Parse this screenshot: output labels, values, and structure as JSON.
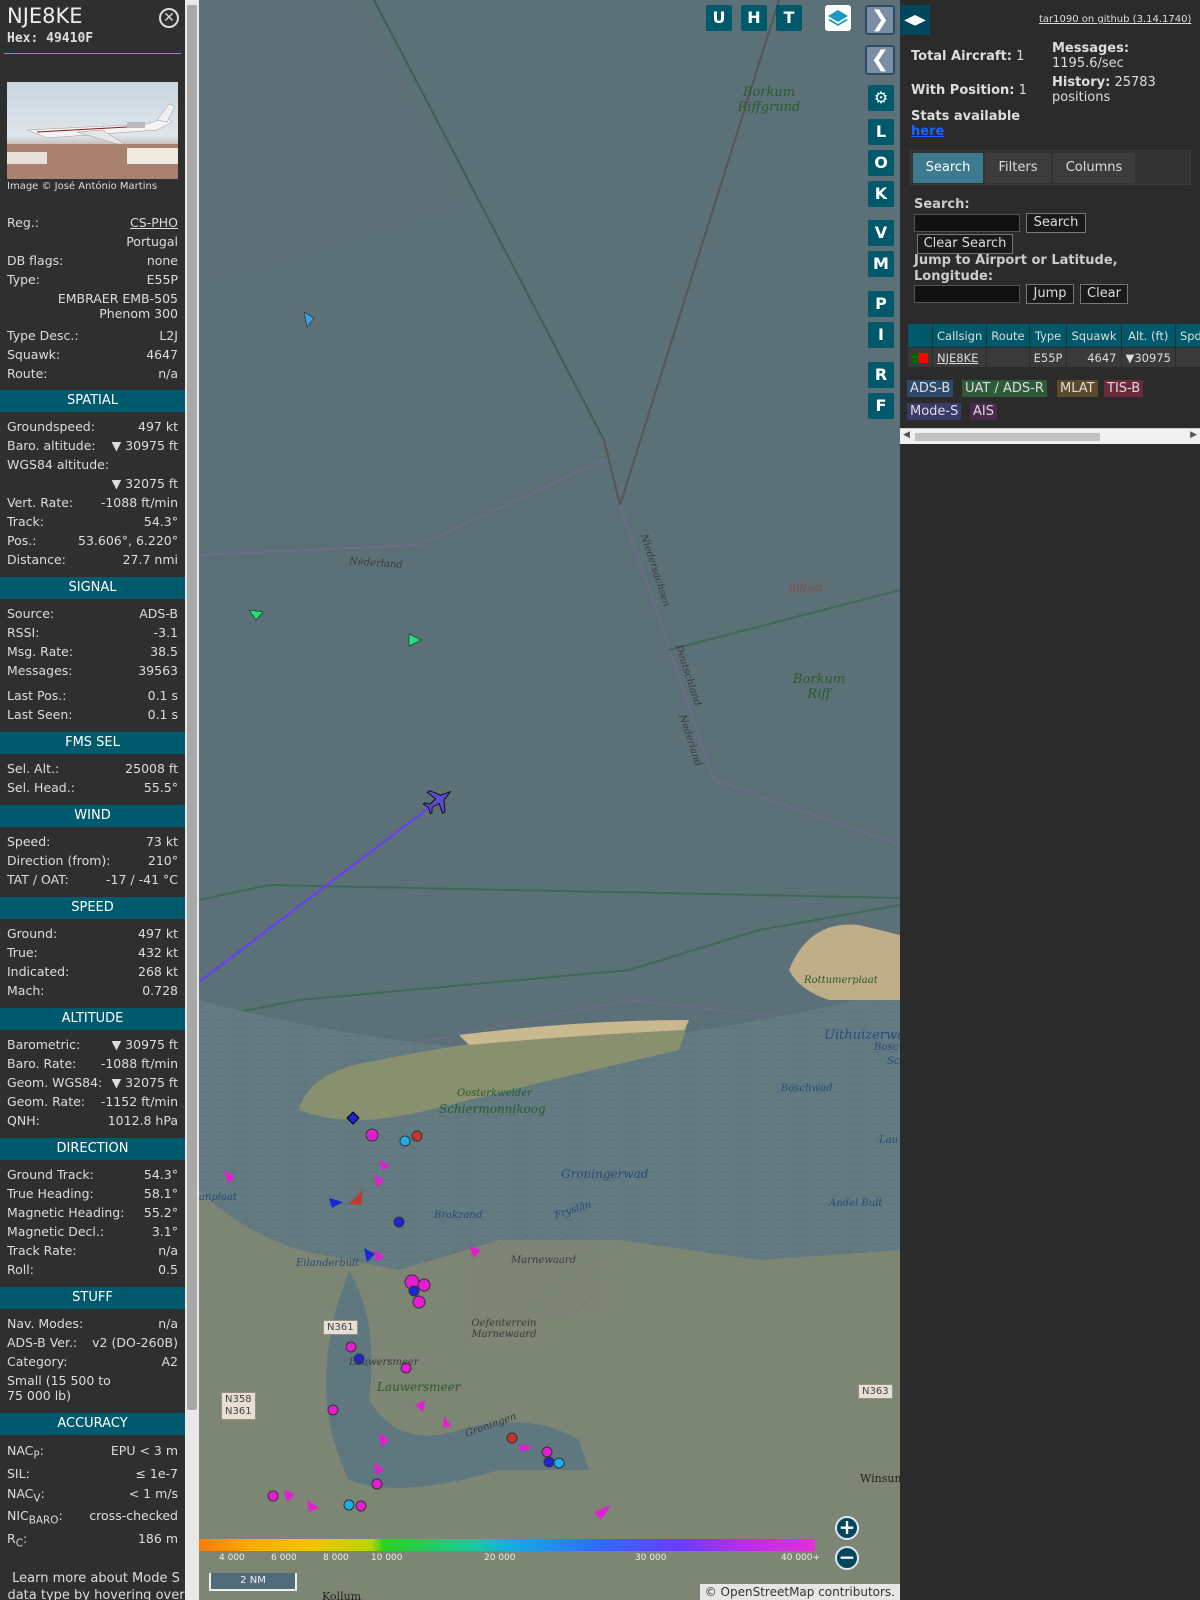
{
  "aircraft": {
    "callsign": "NJE8KE",
    "hex_label": "Hex:",
    "hex": "49410F",
    "photo_credit": "Image © José António Martins",
    "reg_label": "Reg.:",
    "reg": "CS-PHO",
    "country": "Portugal",
    "db_flags_label": "DB flags:",
    "db_flags": "none",
    "type_label": "Type:",
    "type": "E55P",
    "type_name": "EMBRAER EMB-505 Phenom 300",
    "type_desc_label": "Type Desc.:",
    "type_desc": "L2J",
    "squawk_label": "Squawk:",
    "squawk": "4647",
    "route_label": "Route:",
    "route": "n/a"
  },
  "sections": {
    "spatial": "SPATIAL",
    "signal": "SIGNAL",
    "fms": "FMS SEL",
    "wind": "WIND",
    "speed": "SPEED",
    "altitude": "ALTITUDE",
    "direction": "DIRECTION",
    "stuff": "STUFF",
    "accuracy": "ACCURACY"
  },
  "spatial": [
    {
      "label": "Groundspeed:",
      "value": "497 kt"
    },
    {
      "label": "Baro. altitude:",
      "value": "▼ 30975 ft"
    },
    {
      "label": "WGS84 altitude:",
      "value": "▼ 32075 ft"
    },
    {
      "label": "Vert. Rate:",
      "value": "-1088 ft/min"
    },
    {
      "label": "Track:",
      "value": "54.3°"
    },
    {
      "label": "Pos.:",
      "value": "53.606°, 6.220°"
    },
    {
      "label": "Distance:",
      "value": "27.7 nmi"
    }
  ],
  "signal": [
    {
      "label": "Source:",
      "value": "ADS-B"
    },
    {
      "label": "RSSI:",
      "value": "-3.1"
    },
    {
      "label": "Msg. Rate:",
      "value": "38.5"
    },
    {
      "label": "Messages:",
      "value": "39563"
    },
    {
      "label": "Last Pos.:",
      "value": "0.1 s"
    },
    {
      "label": "Last Seen:",
      "value": "0.1 s"
    }
  ],
  "fms": [
    {
      "label": "Sel. Alt.:",
      "value": "25008 ft"
    },
    {
      "label": "Sel. Head.:",
      "value": "55.5°"
    }
  ],
  "wind": [
    {
      "label": "Speed:",
      "value": "73 kt"
    },
    {
      "label": "Direction (from):",
      "value": "210°"
    },
    {
      "label": "TAT / OAT:",
      "value": "-17 / -41 °C"
    }
  ],
  "speed": [
    {
      "label": "Ground:",
      "value": "497 kt"
    },
    {
      "label": "True:",
      "value": "432 kt"
    },
    {
      "label": "Indicated:",
      "value": "268 kt"
    },
    {
      "label": "Mach:",
      "value": "0.728"
    }
  ],
  "altitude": [
    {
      "label": "Barometric:",
      "value": "▼ 30975 ft"
    },
    {
      "label": "Baro. Rate:",
      "value": "-1088 ft/min"
    },
    {
      "label": "Geom. WGS84:",
      "value": "▼ 32075 ft"
    },
    {
      "label": "Geom. Rate:",
      "value": "-1152 ft/min"
    },
    {
      "label": "QNH:",
      "value": "1012.8 hPa"
    }
  ],
  "direction": [
    {
      "label": "Ground Track:",
      "value": "54.3°"
    },
    {
      "label": "True Heading:",
      "value": "58.1°"
    },
    {
      "label": "Magnetic Heading:",
      "value": "55.2°"
    },
    {
      "label": "Magnetic Decl.:",
      "value": "3.1°"
    },
    {
      "label": "Track Rate:",
      "value": "n/a"
    },
    {
      "label": "Roll:",
      "value": "0.5"
    }
  ],
  "stuff": [
    {
      "label": "Nav. Modes:",
      "value": "n/a"
    },
    {
      "label": "ADS-B Ver.:",
      "value": "v2 (DO-260B)"
    },
    {
      "label": "Category:",
      "value": "A2"
    }
  ],
  "stuff_category_desc": "Small (15 500 to 75 000 lb)",
  "accuracy": [
    {
      "label": "NAC",
      "sub": "P",
      "value": "EPU < 3 m"
    },
    {
      "label": "SIL:",
      "sub": "",
      "value": "≤ 1e-7"
    },
    {
      "label": "NAC",
      "sub": "V",
      "value": "< 1 m/s"
    },
    {
      "label": "NIC",
      "sub": "BARO",
      "value": "cross-checked"
    },
    {
      "label": "R",
      "sub": "C",
      "value": "186 m"
    }
  ],
  "footer_note": "Learn more about Mode S data type by hovering over",
  "map": {
    "buttons_top": [
      "U",
      "H",
      "T"
    ],
    "buttons_side": [
      "L",
      "O",
      "K",
      "V",
      "M",
      "P",
      "I",
      "R",
      "F"
    ],
    "labels": {
      "borkum_riffgrund": "Borkum Riffgrund",
      "borkum_riff": "Borkum Riff",
      "riffgat": "Riffgat",
      "nederland_top": "Nederland",
      "niedersachsen": "Niedersachsen",
      "deutschland": "Deutschland",
      "nederland_side": "Nederland",
      "rottumerplaat": "Rottumerplaat",
      "uithuizerwad": "Uithuizerwa",
      "bosch": "Bosc",
      "sc": "Sc",
      "boschwad": "Boschwad",
      "oosterkwelder": "Oosterkwelder",
      "schiermonnikoog": "Schiermonnikoog",
      "groningerwad": "Groningerwad",
      "eryslan": "Fryslân",
      "brakzand": "Brakzand",
      "eilanderbult": "Eilanderbult",
      "marnewaard": "Marnewaard",
      "oefenterrein": "Oefenterrein Marnewaard",
      "lauwersmeer_sm": "Lauwersmeer",
      "lauwersmeer": "Lauwersmeer",
      "groningen": "Groningen",
      "andel_bult": "Andel Bult",
      "plaat": "anplaat",
      "winsum": "Winsum",
      "kollum": "Kollum",
      "lau": "Lau"
    },
    "roads": [
      "N361",
      "N358",
      "N361",
      "N363"
    ],
    "colorbar_labels": [
      "4 000",
      "6 000",
      "8 000",
      "10 000",
      "20 000",
      "30 000",
      "40 000+"
    ],
    "scale": "2 NM",
    "attribution": "© OpenStreetMap contributors."
  },
  "sidebar": {
    "github": "tar1090 on github (3.14.1740)",
    "total_aircraft_label": "Total Aircraft:",
    "total_aircraft": "1",
    "messages_label": "Messages:",
    "messages": "1195.6/sec",
    "with_position_label": "With Position:",
    "with_position": "1",
    "history_label": "History:",
    "history": "25783 positions",
    "stats_label": "Stats available",
    "stats_link": "here",
    "tabs": [
      "Search",
      "Filters",
      "Columns"
    ],
    "search_label": "Search:",
    "search_button": "Search",
    "clear_search_button": "Clear Search",
    "jump_label": "Jump to Airport or Latitude, Longitude:",
    "jump_button": "Jump",
    "clear_button": "Clear",
    "table": {
      "headers": [
        "",
        "Callsign",
        "Route",
        "Type",
        "Squawk",
        "Alt. (ft)",
        "Spd"
      ],
      "row": {
        "callsign": "NJE8KE",
        "route": "",
        "type": "E55P",
        "squawk": "4647",
        "alt": "▼30975",
        "spd": ""
      }
    },
    "legend": [
      {
        "label": "ADS-B",
        "bg": "#2d4a6a",
        "fg": "#ddd"
      },
      {
        "label": "UAT / ADS-R",
        "bg": "#2f5a3a",
        "fg": "#ddd"
      },
      {
        "label": "MLAT",
        "bg": "#5a4a2a",
        "fg": "#ddd"
      },
      {
        "label": "TIS-B",
        "bg": "#6a2a3a",
        "fg": "#ddd"
      },
      {
        "label": "Mode-S",
        "bg": "#3a3a6a",
        "fg": "#ddd"
      },
      {
        "label": "AIS",
        "bg": "#4a2a4a",
        "fg": "#ddd"
      }
    ]
  },
  "colors": {
    "accent": "#005a6e",
    "panel_bg": "#2f2f2f",
    "map_water": "#5b7077",
    "track_line": "#6a3cff"
  }
}
